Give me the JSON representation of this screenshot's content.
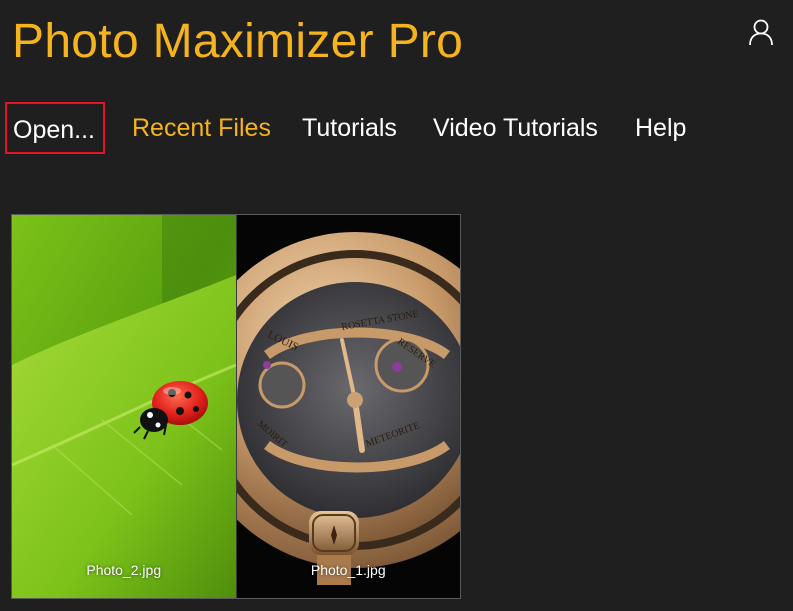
{
  "app": {
    "title": "Photo Maximizer Pro",
    "accent_color": "#f5b31e",
    "background_color": "#1f1f1f"
  },
  "header": {
    "account_icon": "user-icon"
  },
  "nav": {
    "items": [
      {
        "label": "Open...",
        "state": "selected"
      },
      {
        "label": "Recent Files",
        "state": "active"
      },
      {
        "label": "Tutorials",
        "state": "normal"
      },
      {
        "label": "Video Tutorials",
        "state": "normal"
      },
      {
        "label": "Help",
        "state": "normal"
      }
    ],
    "selection_color": "#e81123"
  },
  "recent_files": {
    "items": [
      {
        "filename": "Photo_2.jpg",
        "subject": "ladybug on green leaf"
      },
      {
        "filename": "Photo_1.jpg",
        "subject": "gold mechanical watch"
      }
    ],
    "watch_dial_text": [
      "LOUIS",
      "ROSETTA STONE",
      "RESERVE",
      "METEORITE",
      "MOIRIT"
    ]
  }
}
